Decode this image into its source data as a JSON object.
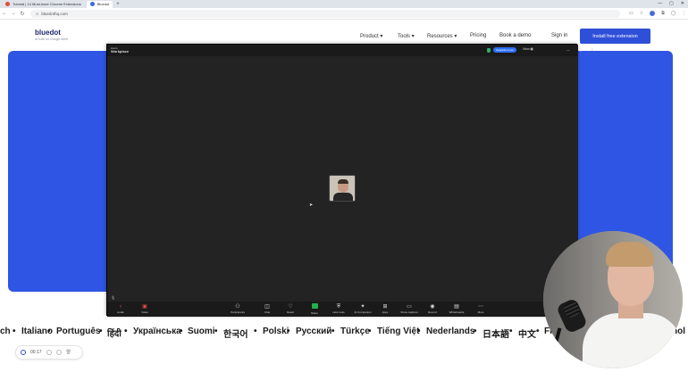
{
  "browser": {
    "tabs": [
      {
        "label": "Tutorial | 14 Must-have Chrome Extensions",
        "active": false,
        "accent": "red"
      },
      {
        "label": "Bluedot",
        "active": true,
        "accent": "blue"
      }
    ],
    "new_tab": "+",
    "url": "bluedothq.com",
    "window_controls": [
      "—",
      "▢",
      "✕"
    ]
  },
  "site": {
    "logo": "bluedot",
    "logo_sub": "AI note for Google Meet",
    "nav": [
      "Product ▾",
      "Tools ▾",
      "Resources ▾",
      "Pricing",
      "Book a demo",
      "Sign in"
    ],
    "cta": "Install free extension",
    "accent": "#2f55e4"
  },
  "zoom": {
    "logo_top": "zoom",
    "logo_bottom": "Workplace",
    "upgrade": "Upgrade to pro",
    "view": "View",
    "window_controls": [
      "—",
      "▢",
      "✕"
    ],
    "controls": [
      {
        "label": "Audio",
        "icon": "mic-muted-icon"
      },
      {
        "label": "Video",
        "icon": "video-off-icon"
      },
      {
        "label": "Participants",
        "icon": "participants-icon"
      },
      {
        "label": "Chat",
        "icon": "chat-icon"
      },
      {
        "label": "React",
        "icon": "react-icon"
      },
      {
        "label": "Share",
        "icon": "share-icon"
      },
      {
        "label": "Host tools",
        "icon": "host-tools-icon"
      },
      {
        "label": "AI Companion",
        "icon": "ai-companion-icon"
      },
      {
        "label": "Apps",
        "icon": "apps-icon"
      },
      {
        "label": "Show captions",
        "icon": "captions-icon"
      },
      {
        "label": "Record",
        "icon": "record-icon"
      },
      {
        "label": "Whiteboards",
        "icon": "whiteboard-icon"
      },
      {
        "label": "More",
        "icon": "more-icon"
      }
    ]
  },
  "languages": [
    "ch",
    "Italiano",
    "Português",
    "हिंदी",
    "Українська",
    "Suomi",
    "한국어",
    "Polski",
    "Русский",
    "Türkçe",
    "Tiếng Việt",
    "Nederlands",
    "日本語",
    "中文",
    "Fr",
    "nol"
  ],
  "recorder": {
    "time": "00:17"
  }
}
